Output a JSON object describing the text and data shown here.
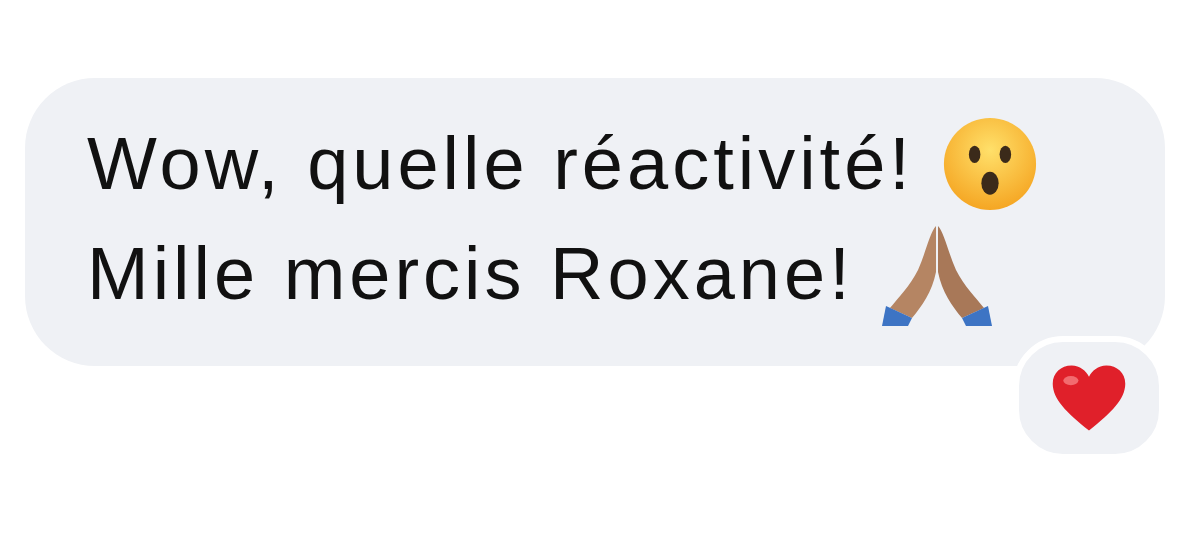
{
  "message": {
    "lines": [
      {
        "text": "Wow, quelle réactivité!",
        "kind": "surprised"
      },
      {
        "text": "Mille mercis Roxane!",
        "kind": "praying"
      }
    ]
  },
  "reaction": {
    "kind": "heart"
  }
}
